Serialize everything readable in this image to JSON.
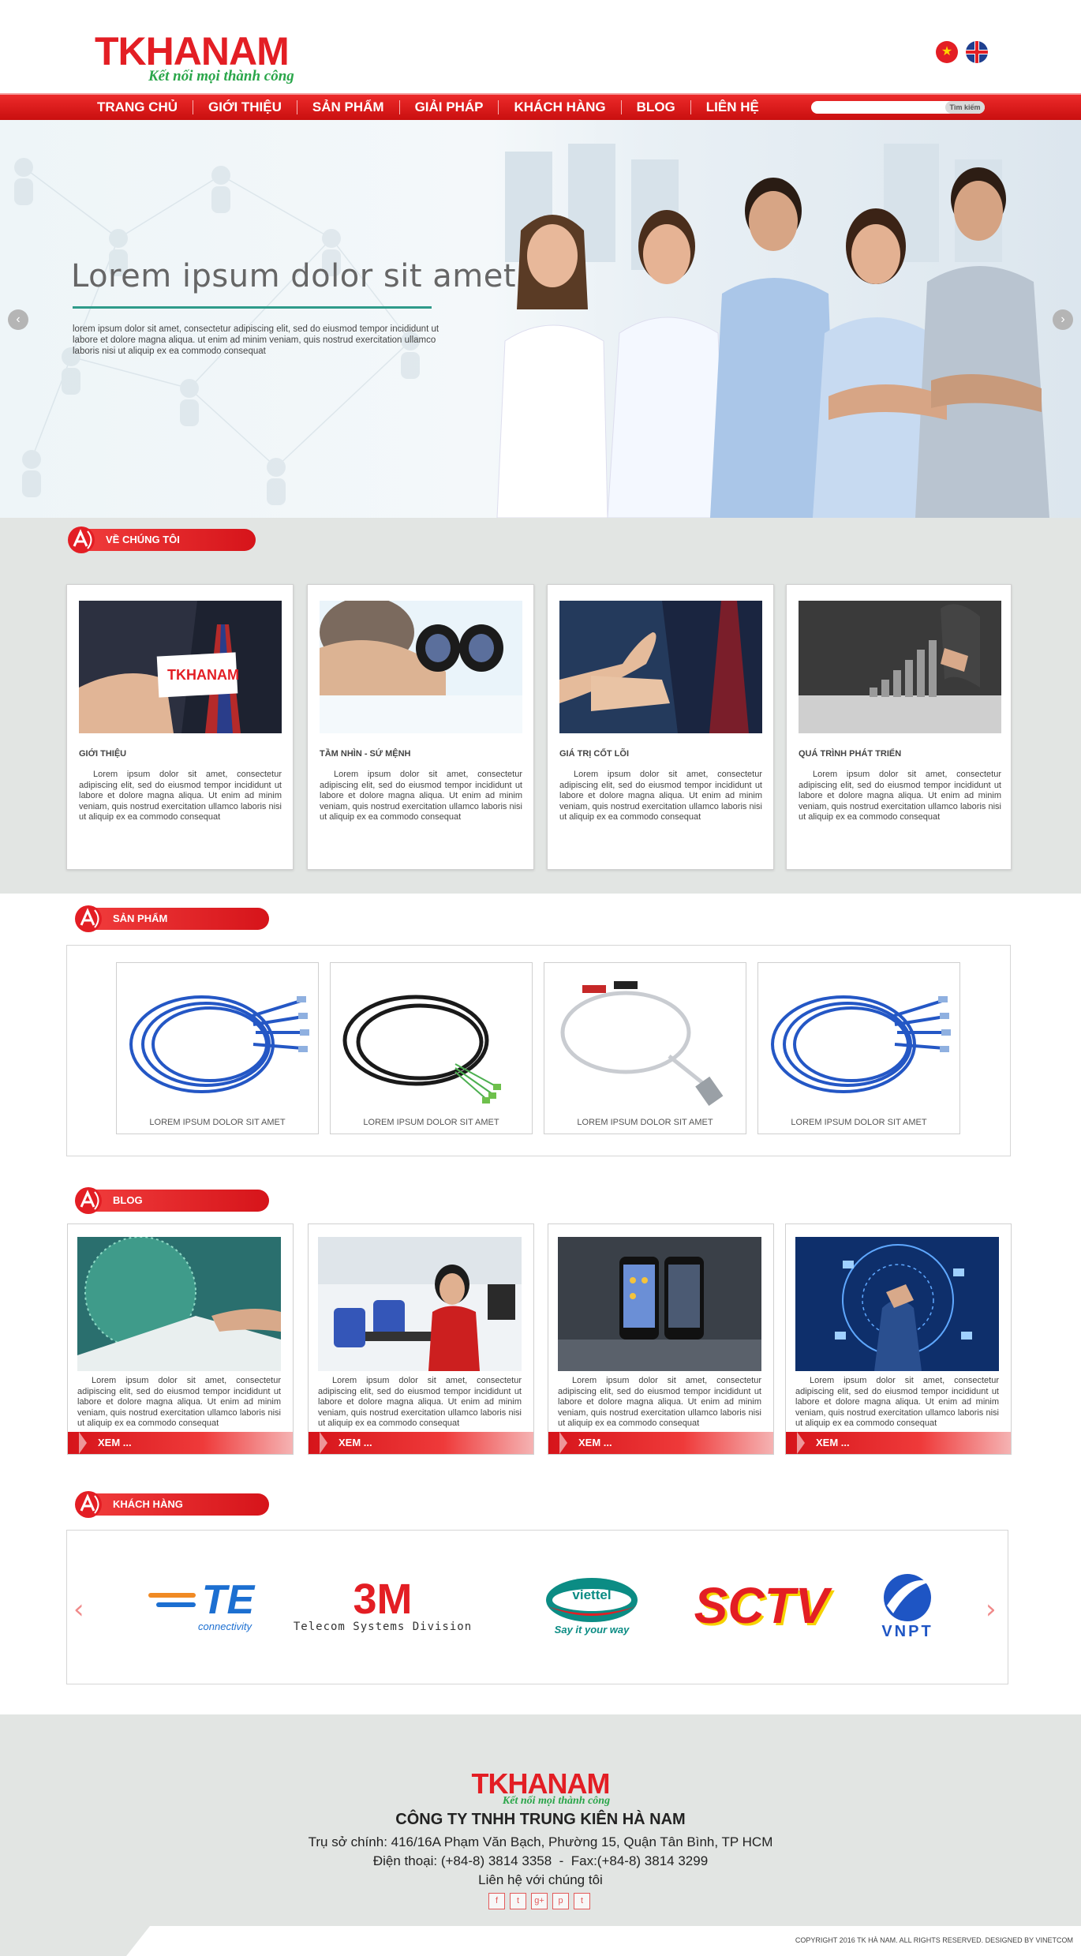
{
  "header": {
    "logo_main": "TKHANAM",
    "logo_tagline": "Kết nối mọi thành công",
    "flags": [
      "vietnam-flag",
      "uk-flag"
    ]
  },
  "nav": {
    "items": [
      "TRANG CHỦ",
      "GIỚI THIỆU",
      "SẢN PHẨM",
      "GIẢI PHÁP",
      "KHÁCH HÀNG",
      "BLOG",
      "LIÊN HỆ"
    ],
    "search_placeholder": "",
    "search_button": "Tìm kiếm"
  },
  "hero": {
    "title": "Lorem ipsum dolor sit amet",
    "text": "lorem ipsum dolor sit amet, consectetur adipiscing elit, sed do eiusmod tempor incididunt ut labore et dolore magna aliqua. ut enim ad minim veniam, quis nostrud exercitation ullamco laboris nisi ut aliquip ex ea commodo consequat",
    "prev": "‹",
    "next": "›"
  },
  "about": {
    "section_label": "VỀ CHÚNG TÔI",
    "cards": [
      {
        "title": "GIỚI THIỆU",
        "text": "Lorem ipsum dolor sit amet, consectetur adipiscing elit, sed do eiusmod tempor incididunt ut labore et dolore magna aliqua. Ut enim ad minim veniam, quis nostrud exercitation ullamco laboris nisi ut aliquip ex ea commodo consequat",
        "card_logo": "TKHANAM"
      },
      {
        "title": "TẦM NHÌN - SỨ MỆNH",
        "text": "Lorem ipsum dolor sit amet, consectetur adipiscing elit, sed do eiusmod tempor incididunt ut labore et dolore magna aliqua. Ut enim ad minim veniam, quis nostrud exercitation ullamco laboris nisi ut aliquip ex ea commodo consequat"
      },
      {
        "title": "GIÁ TRỊ CỐT LÕI",
        "text": "Lorem ipsum dolor sit amet, consectetur adipiscing elit, sed do eiusmod tempor incididunt ut labore et dolore magna aliqua. Ut enim ad minim veniam, quis nostrud exercitation ullamco laboris nisi ut aliquip ex ea commodo consequat"
      },
      {
        "title": "QUÁ TRÌNH PHÁT TRIỂN",
        "text": "Lorem ipsum dolor sit amet, consectetur adipiscing elit, sed do eiusmod tempor incididunt ut labore et dolore magna aliqua. Ut enim ad minim veniam, quis nostrud exercitation ullamco laboris nisi ut aliquip ex ea commodo consequat"
      }
    ]
  },
  "products": {
    "section_label": "SẢN PHẨM",
    "items": [
      {
        "name": "LOREM IPSUM DOLOR SIT AMET"
      },
      {
        "name": "LOREM IPSUM DOLOR SIT AMET"
      },
      {
        "name": "LOREM IPSUM DOLOR SIT AMET"
      },
      {
        "name": "LOREM IPSUM DOLOR SIT AMET"
      }
    ]
  },
  "blog": {
    "section_label": "BLOG",
    "more_label": "XEM ...",
    "items": [
      {
        "text": "Lorem ipsum dolor sit amet, consectetur adipiscing elit, sed do eiusmod tempor incididunt ut labore et dolore magna aliqua. Ut enim ad minim veniam, quis nostrud exercitation ullamco laboris nisi ut aliquip ex ea commodo consequat"
      },
      {
        "text": "Lorem ipsum dolor sit amet, consectetur adipiscing elit, sed do eiusmod tempor incididunt ut labore et dolore magna aliqua. Ut enim ad minim veniam, quis nostrud exercitation ullamco laboris nisi ut aliquip ex ea commodo consequat"
      },
      {
        "text": "Lorem ipsum dolor sit amet, consectetur adipiscing elit, sed do eiusmod tempor incididunt ut labore et dolore magna aliqua. Ut enim ad minim veniam, quis nostrud exercitation ullamco laboris nisi ut aliquip ex ea commodo consequat"
      },
      {
        "text": "Lorem ipsum dolor sit amet, consectetur adipiscing elit, sed do eiusmod tempor incididunt ut labore et dolore magna aliqua. Ut enim ad minim veniam, quis nostrud exercitation ullamco laboris nisi ut aliquip ex ea commodo consequat"
      }
    ]
  },
  "clients": {
    "section_label": "KHÁCH HÀNG",
    "prev": "‹",
    "next": "›",
    "logos": [
      {
        "main": "TE",
        "sub": "connectivity"
      },
      {
        "main": "3M",
        "sub": "Telecom Systems Division"
      },
      {
        "main": "viettel",
        "sub": "Say it your way"
      },
      {
        "main": "SCTV",
        "sub": ""
      },
      {
        "main": "VNPT",
        "sub": ""
      }
    ]
  },
  "footer": {
    "logo_main": "TKHANAM",
    "logo_tagline": "Kết nối mọi thành công",
    "company": "CÔNG TY TNHH TRUNG KIÊN HÀ NAM",
    "address": "Trụ sở chính: 416/16A Phạm Văn Bạch, Phường 15, Quận Tân Bình, TP HCM",
    "phone": "Điện thoại: (+84-8) 3814 3358  -  Fax:(+84-8) 3814 3299",
    "contact": "Liên hệ với chúng tôi",
    "socials": [
      "f",
      "t",
      "g+",
      "p",
      "t"
    ],
    "copyright": "COPYRIGHT 2016 TK HÀ NAM. ALL RIGHTS RESERVED. DESIGNED BY VINETCOM"
  },
  "colors": {
    "brand_red": "#e31e24",
    "tagline_green": "#2aa64a",
    "band_gray": "#e2e5e3"
  }
}
